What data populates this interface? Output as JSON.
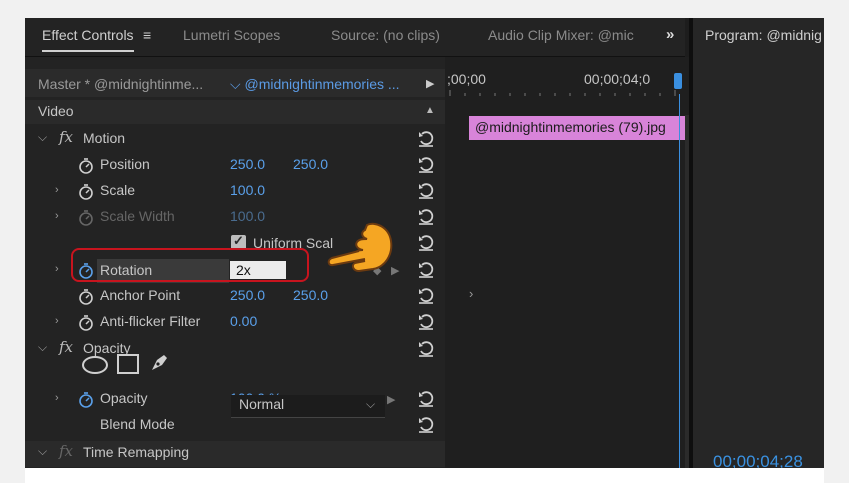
{
  "tabs": [
    {
      "label": "Effect Controls"
    },
    {
      "label": "Lumetri Scopes"
    },
    {
      "label": "Source: (no clips)"
    },
    {
      "label": "Audio Clip Mixer: @mic"
    }
  ],
  "tab_menu_icon": "≡",
  "more_tabs_icon": "»",
  "program_monitor": {
    "title": "Program: @midnig",
    "timecode": "00;00;04;28"
  },
  "header": {
    "master": "Master * @midnightinme...",
    "clip_dropdown": "⌵  @midnightinmemories ..."
  },
  "video_label": "Video",
  "effects": {
    "motion": {
      "label": "Motion",
      "position": {
        "label": "Position",
        "x": "250.0",
        "y": "250.0"
      },
      "scale": {
        "label": "Scale",
        "value": "100.0"
      },
      "scale_width": {
        "label": "Scale Width",
        "value": "100.0"
      },
      "uniform_scale": {
        "label": "Uniform Scal"
      },
      "rotation": {
        "label": "Rotation",
        "value": "2x"
      },
      "anchor_point": {
        "label": "Anchor Point",
        "x": "250.0",
        "y": "250.0"
      },
      "anti_flicker": {
        "label": "Anti-flicker Filter",
        "value": "0.00"
      }
    },
    "opacity": {
      "label": "Opacity",
      "opacity": {
        "label": "Opacity",
        "value": "100.0 %"
      },
      "blend_mode": {
        "label": "Blend Mode",
        "value": "Normal"
      }
    },
    "time_remapping": {
      "label": "Time Remapping"
    }
  },
  "timeline": {
    "start_tc": ";00;00",
    "end_tc": "00;00;04;0",
    "clip_name": "@midnightinmemories (79).jpg"
  },
  "colors": {
    "accent_blue": "#5aa0ea",
    "clip_pink": "#d884d9",
    "highlight_red": "#c8141e"
  }
}
